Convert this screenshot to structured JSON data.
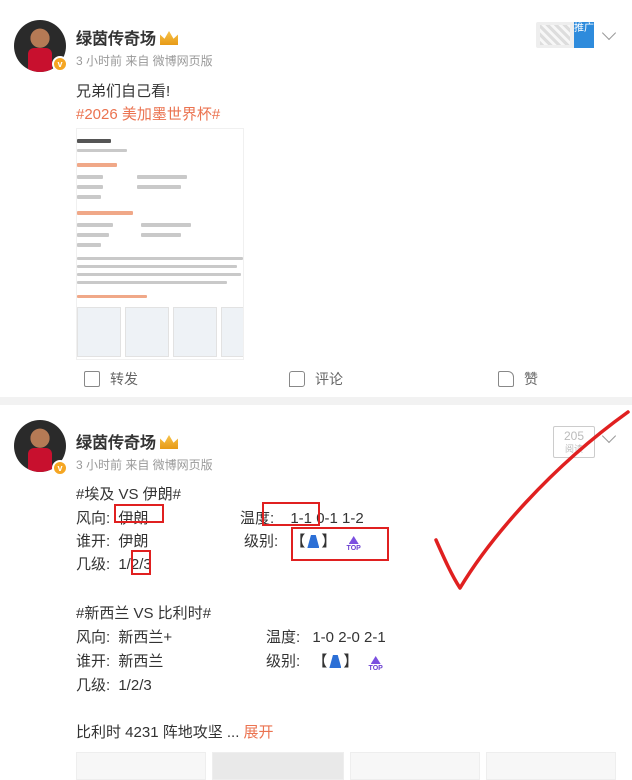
{
  "post1": {
    "author": "绿茵传奇场",
    "meta": "3 小时前  来自  微博网页版",
    "body": "兄弟们自己看!",
    "hashtag": "#2026 美加墨世界杯#",
    "promo_tag": "推广",
    "actions": {
      "forward": "转发",
      "comment": "评论",
      "like": "赞"
    }
  },
  "post2": {
    "author": "绿茵传奇场",
    "meta": "3 小时前  来自  微博网页版",
    "counter_value": "205",
    "counter_sub": "阅读",
    "match1": {
      "title": "#埃及 VS 伊朗#",
      "wind_label": "风向:",
      "wind_value": "伊朗",
      "temp_label": "温度:",
      "temp_value": "1-1 0-1 1-2",
      "open_label": "谁开:",
      "open_value": "伊朗",
      "level_label": "级别:",
      "bracket_open": "【",
      "bracket_close": "】",
      "grade_label": "几级:",
      "grade_value": "1/2/3",
      "top_text": "TOP"
    },
    "match2": {
      "title": "#新西兰 VS 比利时#",
      "wind_label": "风向:",
      "wind_value": "新西兰+",
      "temp_label": "温度:",
      "temp_value": "1-0 2-0 2-1",
      "open_label": "谁开:",
      "open_value": "新西兰",
      "level_label": "级别:",
      "bracket_open": "【",
      "bracket_close": "】",
      "grade_label": "几级:",
      "grade_value": "1/2/3",
      "top_text": "TOP"
    },
    "summary": "比利时 4231 阵地攻坚  ...",
    "expand": "展开"
  },
  "colors": {
    "accent": "#eb7350",
    "annotation_red": "#e02020",
    "level_blue": "#2b6fd6",
    "top_purple": "#7b4fe0"
  },
  "icons": [
    "forward-icon",
    "comment-icon",
    "like-icon",
    "crown-icon",
    "verified-icon",
    "chevron-down-icon",
    "level-icon",
    "top-icon"
  ]
}
